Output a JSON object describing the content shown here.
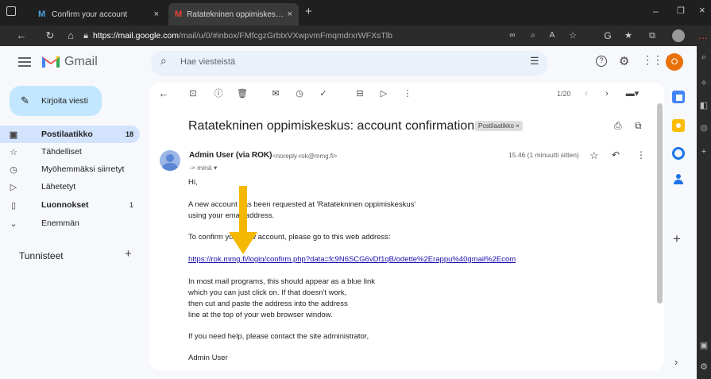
{
  "browser": {
    "tabs": [
      {
        "title": "Confirm your account",
        "close": "×"
      },
      {
        "title": "Ratatekninen oppimiskeskus: acc",
        "close": "×"
      }
    ],
    "new_tab": "+",
    "url_host": "https://mail.google.com",
    "url_path": "/mail/u/0/#inbox/FMfcgzGrbtxVXwpvmFmqmdrxrWFXsTlb",
    "window_controls": [
      "–",
      "❐",
      "×"
    ]
  },
  "gmail": {
    "brand": "Gmail",
    "search_placeholder": "Hae viesteistä",
    "compose_label": "Kirjoita viesti",
    "avatar_letter": "O",
    "nav": [
      {
        "label": "Postilaatikko",
        "count": "18",
        "icon": "inbox-icon"
      },
      {
        "label": "Tähdelliset",
        "count": "",
        "icon": "star-icon"
      },
      {
        "label": "Myöhemmäksi siirretyt",
        "count": "",
        "icon": "clock-icon"
      },
      {
        "label": "Lähetetyt",
        "count": "",
        "icon": "send-icon"
      },
      {
        "label": "Luonnokset",
        "count": "1",
        "icon": "draft-icon"
      },
      {
        "label": "Enemmän",
        "count": "",
        "icon": "chevron-down-icon"
      }
    ],
    "labels_heading": "Tunnisteet",
    "labels_add": "+",
    "pager": "1/20"
  },
  "email": {
    "subject": "Ratatekninen oppimiskeskus: account confirmation",
    "label_chip": "Postilaatikko ×",
    "sender_name": "Admin User (via ROK)",
    "sender_email": "<noreply-rok@mmg.fi>",
    "to_line": "-> minä ▾",
    "time": "15.46 (1 minuutti sitten)",
    "body": {
      "greeting": "Hi,",
      "p1_line1": "A new account has been requested at 'Ratatekninen oppimiskeskus'",
      "p1_line2": "using your email address.",
      "p2": "To confirm your new account, please go to this web address:",
      "link": "https://rok.mmg.fi/login/confirm.php?data=fc9N6SCG6vDf1qB/odette%2Erappu%40gmail%2Ecom",
      "p3_line1": "In most mail programs, this should appear as a blue link",
      "p3_line2": "which you can just click on. If that doesn't work,",
      "p3_line3": "then cut and paste the address into the address",
      "p3_line4": "line at the top of your web browser window.",
      "p4": "If you need help, please contact the site administrator,",
      "signature": "Admin User"
    }
  },
  "colors": {
    "arrow": "#f5b800",
    "link": "#1a0dab",
    "gmail_red": "#ea4335",
    "avatar_bg": "#e8710a",
    "selected_nav": "#d3e3fd",
    "compose_bg": "#c2e7ff"
  }
}
